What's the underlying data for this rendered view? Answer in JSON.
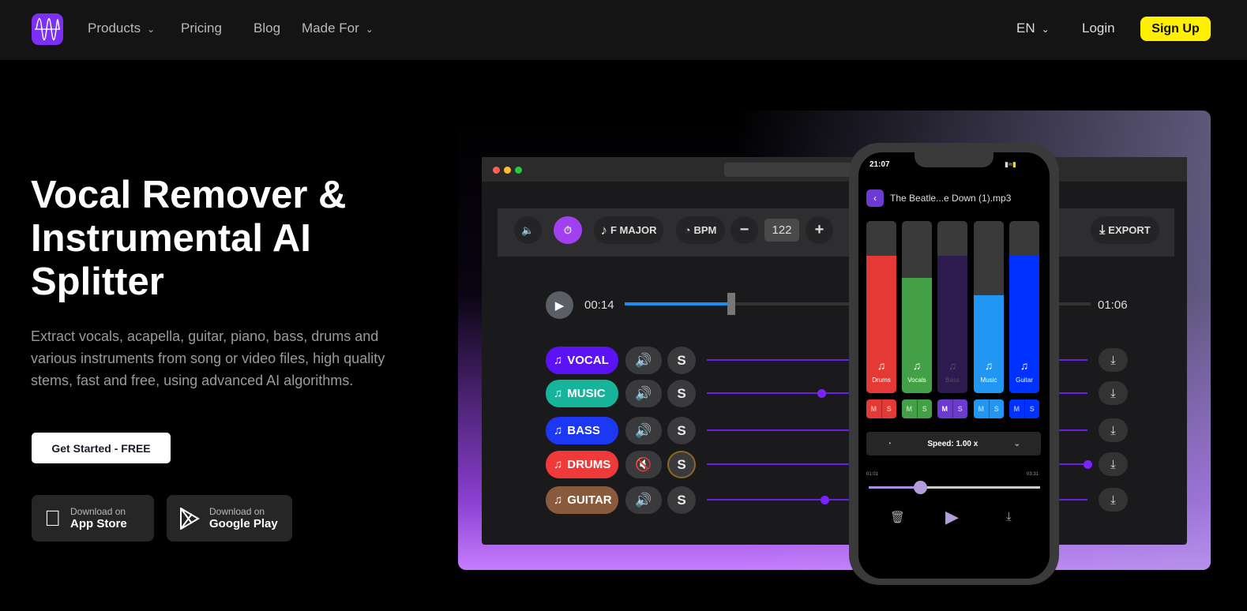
{
  "header": {
    "nav": [
      {
        "label": "Products",
        "dropdown": true
      },
      {
        "label": "Pricing"
      },
      {
        "label": "Blog"
      },
      {
        "label": "Made For",
        "dropdown": true
      }
    ],
    "language": "EN",
    "login": "Login",
    "signup": "Sign Up"
  },
  "hero": {
    "title": "Vocal Remover & Instrumental AI Splitter",
    "description": "Extract vocals, acapella, guitar, piano, bass, drums and various instruments from song or video files, high quality stems, fast and free, using advanced AI algorithms.",
    "cta": "Get Started - FREE",
    "stores": [
      {
        "top": "Download on",
        "name": "App Store",
        "icon": "apple-icon"
      },
      {
        "top": "Download on",
        "name": "Google Play",
        "icon": "google-play-icon"
      }
    ]
  },
  "desktop": {
    "key": "F MAJOR",
    "bpm_label": "BPM",
    "bpm": "122",
    "export": "EXPORT",
    "time_current": "00:14",
    "time_total": "01:06",
    "progress": 0.22,
    "stems": [
      {
        "label": "VOCAL",
        "color": "#5b12f5",
        "muted": false,
        "level": null
      },
      {
        "label": "MUSIC",
        "color": "#17b39a",
        "muted": false,
        "level": 0.3
      },
      {
        "label": "BASS",
        "color": "#1c38f5",
        "muted": false,
        "level": null
      },
      {
        "label": "DRUMS",
        "color": "#f03a3a",
        "muted": true,
        "solo_highlight": true,
        "level": 1.0
      },
      {
        "label": "GUITAR",
        "color": "#8a5a3c",
        "muted": false,
        "level": 0.31
      }
    ],
    "solo_label": "S"
  },
  "phone": {
    "clock": "21:07",
    "file": "The Beatle...e Down (1).mp3",
    "tracks": [
      {
        "label": "Drums",
        "color": "#e53935",
        "level": 0.8
      },
      {
        "label": "Vocals",
        "color": "#43a047",
        "level": 0.67
      },
      {
        "label": "Bass",
        "color": "#2d1a4f",
        "level": 0.8,
        "muted": true
      },
      {
        "label": "Music",
        "color": "#2196f3",
        "level": 0.57
      },
      {
        "label": "Guitar",
        "color": "#0032ff",
        "level": 0.8
      }
    ],
    "mute_label": "M",
    "solo_label": "S",
    "speed": "Speed: 1.00 x",
    "time_current": "01:01",
    "time_total": "03:31",
    "progress": 0.3
  }
}
